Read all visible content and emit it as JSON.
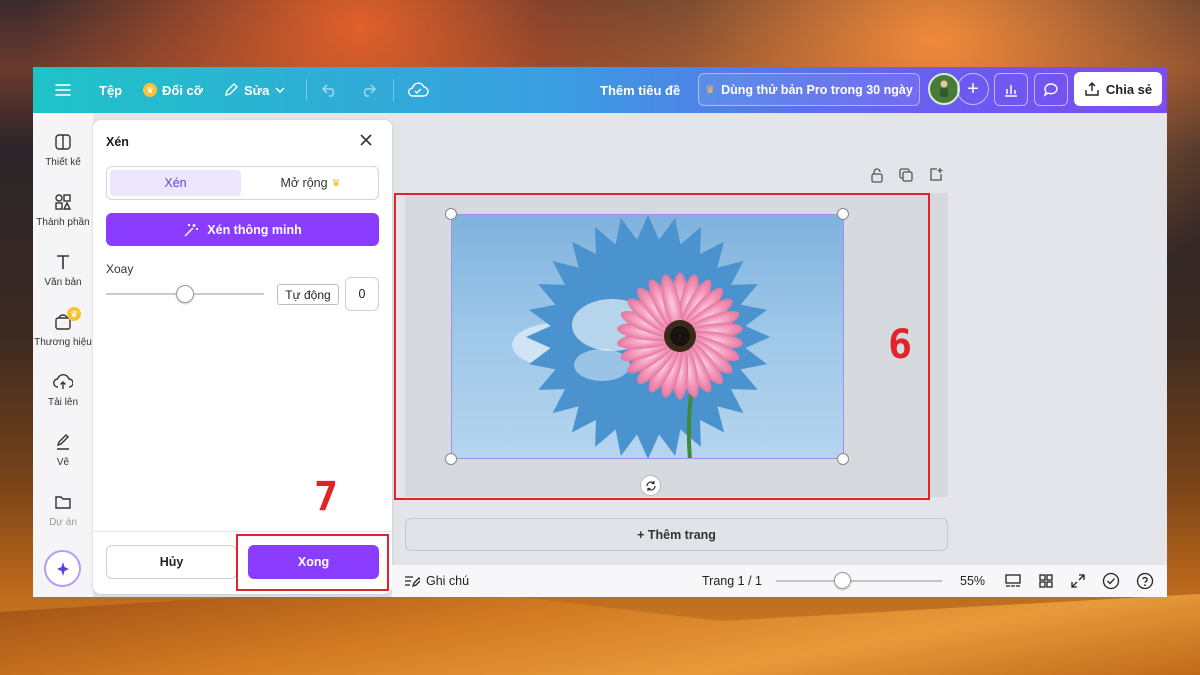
{
  "topbar": {
    "file": "Tệp",
    "resize": "Đổi cỡ",
    "edit": "Sửa",
    "doc_title": "Thêm tiêu đề",
    "pro_trial": "Dùng thử bản Pro trong 30 ngày",
    "share": "Chia sẻ"
  },
  "sidebar": {
    "items": [
      {
        "label": "Thiết kế",
        "icon": "layout-icon"
      },
      {
        "label": "Thành phần",
        "icon": "shapes-icon"
      },
      {
        "label": "Văn bản",
        "icon": "text-icon"
      },
      {
        "label": "Thương hiệu",
        "icon": "brand-icon"
      },
      {
        "label": "Tải lên",
        "icon": "upload-cloud-icon"
      },
      {
        "label": "Vẽ",
        "icon": "draw-pen-icon"
      },
      {
        "label": "Dự án",
        "icon": "folder-icon"
      }
    ]
  },
  "crop_panel": {
    "title": "Xén",
    "tab_crop": "Xén",
    "tab_expand": "Mở rộng",
    "smart_crop": "Xén thông minh",
    "rotate_label": "Xoay",
    "auto_button": "Tự động",
    "rotate_value": "0",
    "rotate_slider_fraction": 0.5,
    "cancel": "Hủy",
    "done": "Xong"
  },
  "canvas": {
    "add_page": "+ Thêm trang"
  },
  "bottombar": {
    "notes": "Ghi chú",
    "page_indicator": "Trang 1 / 1",
    "zoom_fraction": 0.4,
    "zoom": "55%"
  },
  "annotations": {
    "step_6": "6",
    "step_7": "7"
  },
  "colors": {
    "accent_purple": "#8b3dff",
    "annotation_red": "#e0242a"
  }
}
